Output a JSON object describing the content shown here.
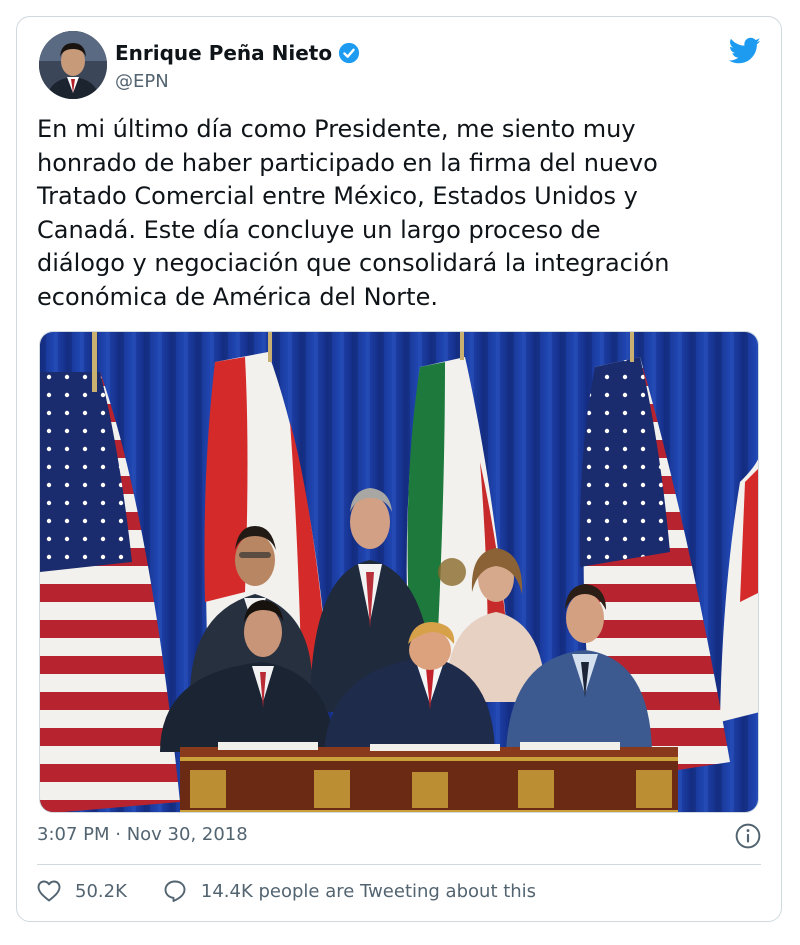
{
  "author": {
    "display_name": "Enrique Peña Nieto",
    "handle": "@EPN",
    "verified": true,
    "avatar_icon": "avatar-photo"
  },
  "platform_icon": "twitter-bird-icon",
  "tweet": {
    "text": "En mi último día como Presidente, me siento muy\nhonrado de haber participado en la firma del nuevo\nTratado Comercial entre México, Estados Unidos y\nCanadá. Este día concluye un largo proceso de\ndiálogo y negociación que consolidará la integración\neconómica de América del Norte.",
    "media": {
      "type": "photo",
      "dominant_colors": {
        "curtain": "#1a3a9c",
        "desk": "#6a2a14",
        "gold": "#c9a03a"
      }
    },
    "timestamp": "3:07 PM · Nov 30, 2018"
  },
  "actions": {
    "likes_count": "50.2K",
    "retweets_text": "14.4K people are Tweeting about this"
  },
  "colors": {
    "text": "#0f1419",
    "secondary": "#536471",
    "twitter_blue": "#1d9bf0",
    "border": "#cfd9de"
  }
}
